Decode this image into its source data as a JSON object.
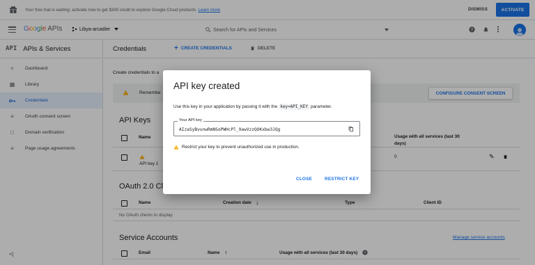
{
  "trial_banner": {
    "message": "Your free trial is waiting: activate now to get $300 credit to explore Google Cloud products.",
    "link": "Learn more",
    "dismiss": "DISMISS",
    "activate": "ACTIVATE"
  },
  "appbar": {
    "logo_google": "Google",
    "logo_apis": "APIs",
    "project": "Libya-arcadier",
    "search_placeholder": "Search for APIs and Services"
  },
  "sidebar": {
    "api_badge": "API",
    "title": "APIs & Services",
    "items": [
      {
        "label": "Dashboard",
        "icon": "dashboard-icon"
      },
      {
        "label": "Library",
        "icon": "library-icon"
      },
      {
        "label": "Credentials",
        "icon": "key-icon",
        "active": true
      },
      {
        "label": "OAuth consent screen",
        "icon": "consent-icon"
      },
      {
        "label": "Domain verification",
        "icon": "domain-icon"
      },
      {
        "label": "Page usage agreements",
        "icon": "settings-icon"
      }
    ],
    "collapse_label": "<|"
  },
  "main": {
    "title": "Credentials",
    "create_credentials": "CREATE CREDENTIALS",
    "delete": "DELETE",
    "intro": "Create credentials to a",
    "consent_text": "Remembe",
    "configure_consent": "CONFIGURE CONSENT SCREEN",
    "api_keys": {
      "title": "API Keys",
      "col_name": "Name",
      "col_usage": "Usage with all services (last 30 days)",
      "row_name": "API key 1",
      "row_usage": "0"
    },
    "oauth": {
      "title": "OAuth 2.0 Cl",
      "col_name": "Name",
      "col_created": "Creation date",
      "col_type": "Type",
      "col_client": "Client ID",
      "empty": "No OAuth clients to display"
    },
    "service_accounts": {
      "title": "Service Accounts",
      "manage": "Manage service accounts",
      "col_email": "Email",
      "col_name": "Name",
      "col_usage": "Usage with all services (last 30 days)"
    }
  },
  "dialog": {
    "title": "API key created",
    "message_before": "Use this key in your application by passing it with the",
    "code": "key=API_KEY",
    "message_after": "parameter.",
    "key_label": "Your API key",
    "key_value": "AIzaSyBvunwRmNSoPWHcPl_9awVzzQOKxbw3JQg",
    "restrict_warning": "Restrict your key to prevent unauthorized use in production.",
    "close": "CLOSE",
    "restrict_key": "RESTRICT KEY"
  },
  "colors": {
    "accent": "#1a73e8",
    "warning": "#f9ab00",
    "scrim": "rgba(0,0,0,0.32)"
  }
}
